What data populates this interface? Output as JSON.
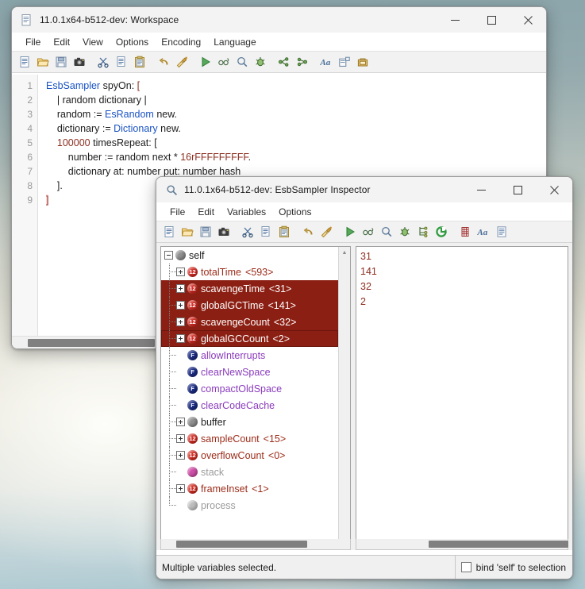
{
  "workspace": {
    "title": "11.0.1x64-b512-dev: Workspace",
    "title_icon": "document-icon",
    "menus": [
      "File",
      "Edit",
      "View",
      "Options",
      "Encoding",
      "Language"
    ],
    "window_buttons": {
      "minimize": "minimize-icon",
      "maximize": "maximize-icon",
      "close": "close-icon"
    },
    "toolbar": [
      "new-file-icon",
      "open-folder-icon",
      "save-icon",
      "snapshot-camera-icon",
      "cut-scissors-icon",
      "copy-icon",
      "paste-icon",
      "undo-icon",
      "redo-icon",
      "run-play-icon",
      "inspect-glasses-icon",
      "search-magnifier-icon",
      "debug-bug-icon",
      "branch-icon",
      "share-nodes-icon",
      "font-icon",
      "layout-icon",
      "toolbox-icon"
    ],
    "line_numbers": [
      "1",
      "2",
      "3",
      "4",
      "5",
      "6",
      "7",
      "8",
      "9"
    ],
    "code_lines": [
      [
        {
          "t": "EsbSampler",
          "c": "cls"
        },
        {
          "t": " spyOn: ",
          "c": "plain"
        },
        {
          "t": "[",
          "c": "brk"
        }
      ],
      [
        {
          "t": "    | random dictionary |",
          "c": "plain"
        }
      ],
      [
        {
          "t": "    random := ",
          "c": "plain"
        },
        {
          "t": "EsRandom",
          "c": "cls"
        },
        {
          "t": " new.",
          "c": "plain"
        }
      ],
      [
        {
          "t": "    dictionary := ",
          "c": "plain"
        },
        {
          "t": "Dictionary",
          "c": "cls"
        },
        {
          "t": " new.",
          "c": "plain"
        }
      ],
      [
        {
          "t": "    ",
          "c": "plain"
        },
        {
          "t": "100000",
          "c": "num"
        },
        {
          "t": " timesRepeat: [",
          "c": "plain"
        }
      ],
      [
        {
          "t": "        number := random next * ",
          "c": "plain"
        },
        {
          "t": "16rFFFFFFFFF",
          "c": "num"
        },
        {
          "t": ".",
          "c": "plain"
        }
      ],
      [
        {
          "t": "        dictionary at: number put: number hash",
          "c": "plain"
        }
      ],
      [
        {
          "t": "    ].",
          "c": "plain"
        }
      ],
      [
        {
          "t": "]",
          "c": "brk-hl"
        }
      ]
    ]
  },
  "inspector": {
    "title": "11.0.1x64-b512-dev: EsbSampler Inspector",
    "title_icon": "magnifier-icon",
    "menus": [
      "File",
      "Edit",
      "Variables",
      "Options"
    ],
    "window_buttons": {
      "minimize": "minimize-icon",
      "maximize": "maximize-icon",
      "close": "close-icon"
    },
    "toolbar": [
      "new-file-icon",
      "open-folder-icon",
      "save-icon",
      "snapshot-camera-icon",
      "cut-scissors-icon",
      "copy-icon",
      "paste-icon",
      "undo-icon",
      "redo-icon",
      "run-play-icon",
      "inspect-glasses-icon",
      "search-magnifier-icon",
      "debug-bug-icon",
      "branch-icon",
      "refresh-icon",
      "grid-icon",
      "font-icon",
      "list-icon"
    ],
    "tree": [
      {
        "label": "self",
        "value": "",
        "badge": "obj",
        "badge_text": "",
        "type": "obj",
        "toggle": "minus",
        "depth": 0,
        "selected": false
      },
      {
        "label": "totalTime",
        "value": "<593>",
        "badge": "int",
        "badge_text": "12",
        "type": "int",
        "toggle": "plus",
        "depth": 1,
        "selected": false
      },
      {
        "label": "scavengeTime",
        "value": "<31>",
        "badge": "int",
        "badge_text": "12",
        "type": "int",
        "toggle": "plus",
        "depth": 1,
        "selected": true
      },
      {
        "label": "globalGCTime",
        "value": "<141>",
        "badge": "int",
        "badge_text": "12",
        "type": "int",
        "toggle": "plus",
        "depth": 1,
        "selected": true
      },
      {
        "label": "scavengeCount",
        "value": "<32>",
        "badge": "int",
        "badge_text": "12",
        "type": "int",
        "toggle": "plus",
        "depth": 1,
        "selected": true
      },
      {
        "label": "globalGCCount",
        "value": "<2>",
        "badge": "int",
        "badge_text": "12",
        "type": "int",
        "toggle": "plus",
        "depth": 1,
        "selected": true,
        "focus": true
      },
      {
        "label": "allowInterrupts",
        "value": "",
        "badge": "bool",
        "badge_text": "F",
        "type": "bool",
        "toggle": "none",
        "depth": 1,
        "selected": false
      },
      {
        "label": "clearNewSpace",
        "value": "",
        "badge": "bool",
        "badge_text": "F",
        "type": "bool",
        "toggle": "none",
        "depth": 1,
        "selected": false
      },
      {
        "label": "compactOldSpace",
        "value": "",
        "badge": "bool",
        "badge_text": "F",
        "type": "bool",
        "toggle": "none",
        "depth": 1,
        "selected": false
      },
      {
        "label": "clearCodeCache",
        "value": "",
        "badge": "bool",
        "badge_text": "F",
        "type": "bool",
        "toggle": "none",
        "depth": 1,
        "selected": false
      },
      {
        "label": "buffer",
        "value": "",
        "badge": "obj",
        "badge_text": "",
        "type": "obj",
        "toggle": "plus",
        "depth": 1,
        "selected": false
      },
      {
        "label": "sampleCount",
        "value": "<15>",
        "badge": "int",
        "badge_text": "12",
        "type": "int",
        "toggle": "plus",
        "depth": 1,
        "selected": false
      },
      {
        "label": "overflowCount",
        "value": "<0>",
        "badge": "int",
        "badge_text": "12",
        "type": "int",
        "toggle": "plus",
        "depth": 1,
        "selected": false
      },
      {
        "label": "stack",
        "value": "",
        "badge": "coll",
        "badge_text": "",
        "type": "dim",
        "toggle": "none",
        "depth": 1,
        "selected": false
      },
      {
        "label": "frameInset",
        "value": "<1>",
        "badge": "int",
        "badge_text": "12",
        "type": "int",
        "toggle": "plus",
        "depth": 1,
        "selected": false
      },
      {
        "label": "process",
        "value": "",
        "badge": "objd",
        "badge_text": "",
        "type": "dim",
        "toggle": "none",
        "depth": 1,
        "selected": false,
        "last": true
      }
    ],
    "values": [
      "31",
      "141",
      "32",
      "2"
    ],
    "status_text": "Multiple variables selected.",
    "bind_checkbox_label": "bind 'self' to selection",
    "bind_checkbox_checked": false
  },
  "colors": {
    "selection_bg": "#8c1f13",
    "integer_label": "#9c2b18",
    "boolean_label": "#8a3bbd",
    "class_token": "#1a53c4",
    "number_token": "#8d2f21"
  }
}
